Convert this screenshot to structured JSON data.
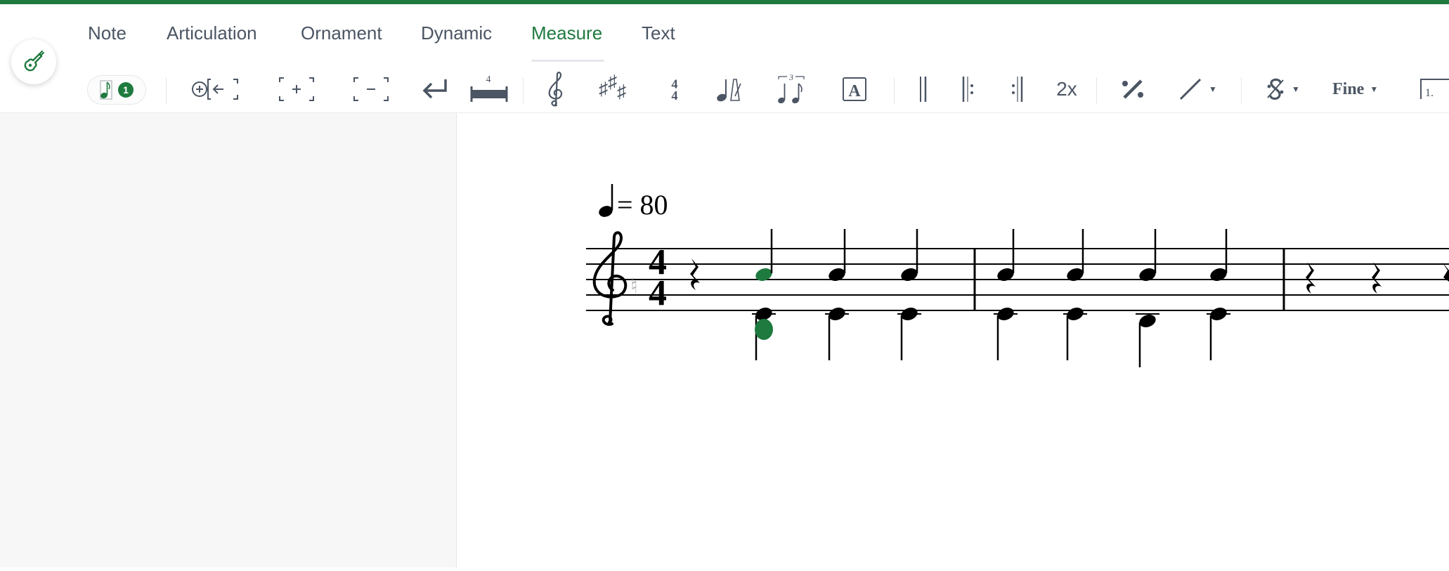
{
  "app": {
    "accent_color": "#1f7a3f",
    "logo_icon": "guitar-icon"
  },
  "tabs": [
    {
      "label": "Note",
      "active": false
    },
    {
      "label": "Articulation",
      "active": false
    },
    {
      "label": "Ornament",
      "active": false
    },
    {
      "label": "Dynamic",
      "active": false
    },
    {
      "label": "Measure",
      "active": true
    },
    {
      "label": "Text",
      "active": false
    }
  ],
  "toolbar": {
    "voice": {
      "icon": "voice-note-icon",
      "badge": "1"
    },
    "insert_measure_icon": "insert-measure-before-icon",
    "add_measure_icon": "add-measure-icon",
    "remove_measure_icon": "remove-measure-icon",
    "line_break_icon": "line-break-icon",
    "multi_rest": {
      "icon": "multi-measure-rest-icon",
      "number": "4"
    },
    "clef_icon": "treble-clef-icon",
    "key_signature_icon": "key-signature-icon",
    "time_signature": {
      "top": "4",
      "bottom": "4"
    },
    "tempo_icon": "metronome-icon",
    "tuplet": {
      "icon": "tuplet-icon",
      "number": "3"
    },
    "text_box": {
      "icon": "text-box-icon",
      "letter": "A"
    },
    "double_barline_icon": "double-barline-icon",
    "repeat_start_icon": "repeat-start-icon",
    "repeat_end_icon": "repeat-end-icon",
    "repeat_count_label": "2x",
    "measure_repeat_icon": "measure-repeat-icon",
    "slash_icon": "slash-notation-icon",
    "segno_icon": "segno-icon",
    "fine_label": "Fine",
    "volta": {
      "icon": "volta-bracket-icon",
      "label": "1."
    }
  },
  "score": {
    "tempo": {
      "note": "quarter",
      "value": "= 80"
    },
    "clef": "treble",
    "time_signature": {
      "top": "4",
      "bottom": "4"
    },
    "highlight_color": "#1f7a3f",
    "note_color": "#000000"
  }
}
